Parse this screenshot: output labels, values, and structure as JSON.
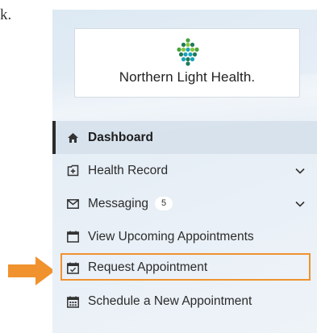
{
  "document": {
    "fragment_text": "k."
  },
  "logo": {
    "brand_text": "Northern Light Health.",
    "colors": [
      "#1f7a5c",
      "#48a23f",
      "#8cc63f",
      "#1aa3b8"
    ]
  },
  "nav": {
    "items": [
      {
        "label": "Dashboard",
        "icon": "home-icon",
        "active": true
      },
      {
        "label": "Health Record",
        "icon": "health-record-icon",
        "expandable": true
      },
      {
        "label": "Messaging",
        "icon": "envelope-icon",
        "badge": "5",
        "expandable": true
      },
      {
        "label": "View Upcoming Appointments",
        "icon": "calendar-icon"
      },
      {
        "label": "Request Appointment",
        "icon": "calendar-check-icon",
        "highlighted": true
      },
      {
        "label": "Schedule a New Appointment",
        "icon": "calendar-grid-icon"
      }
    ]
  },
  "annotation": {
    "highlight_color": "#f0922e",
    "arrow_color": "#f0922e"
  }
}
